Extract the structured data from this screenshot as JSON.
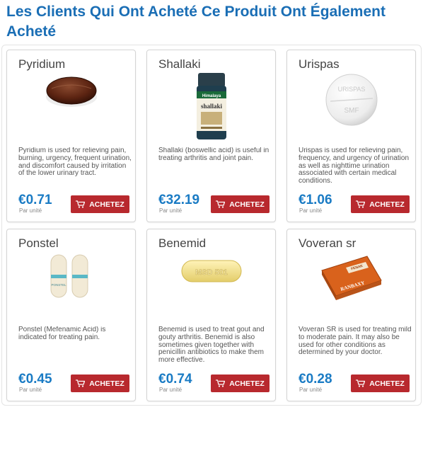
{
  "page": {
    "heading": "Les Clients Qui Ont Acheté Ce Produit Ont Également Acheté"
  },
  "colors": {
    "heading": "#1a6eb5",
    "price": "#1a7bc4",
    "button": "#b8292e"
  },
  "products": [
    {
      "name": "Pyridium",
      "description": "Pyridium is used for relieving pain, burning, urgency, frequent urination, and discomfort caused by irritation of the lower urinary tract.",
      "price": "€0.71",
      "unit": "Par unité",
      "button": "ACHETEZ",
      "icon": "cart-icon"
    },
    {
      "name": "Shallaki",
      "description": "Shallaki (boswellic acid) is useful in treating arthritis and joint pain.",
      "price": "€32.19",
      "unit": "Par unité",
      "button": "ACHETEZ",
      "icon": "cart-icon",
      "bottle_brand": "Himalaya",
      "bottle_label": "shallaki"
    },
    {
      "name": "Urispas",
      "description": "Urispas is used for relieving pain, frequency, and urgency of urination as well as nighttime urination associated with certain medical conditions.",
      "price": "€1.06",
      "unit": "Par unité",
      "button": "ACHETEZ",
      "icon": "cart-icon",
      "tablet_top": "URISPAS",
      "tablet_bottom": "SMF"
    },
    {
      "name": "Ponstel",
      "description": "Ponstel (Mefenamic Acid) is indicated for treating pain.",
      "price": "€0.45",
      "unit": "Par unité",
      "button": "ACHETEZ",
      "icon": "cart-icon",
      "capsule_label": "PONSTEL"
    },
    {
      "name": "Benemid",
      "description": "Benemid is used to treat gout and gouty arthritis. Benemid is also sometimes given together with penicillin antibiotics to make them more effective.",
      "price": "€0.74",
      "unit": "Par unité",
      "button": "ACHETEZ",
      "icon": "cart-icon",
      "tablet_imprint": "MSD 501"
    },
    {
      "name": "Voveran sr",
      "description": "Voveran SR is used for treating mild to moderate pain. It may also be used for other conditions as determined by your doctor.",
      "price": "€0.28",
      "unit": "Par unité",
      "button": "ACHETEZ",
      "icon": "cart-icon",
      "box_brand": "RANBAXY",
      "box_label": "FENAK"
    }
  ]
}
